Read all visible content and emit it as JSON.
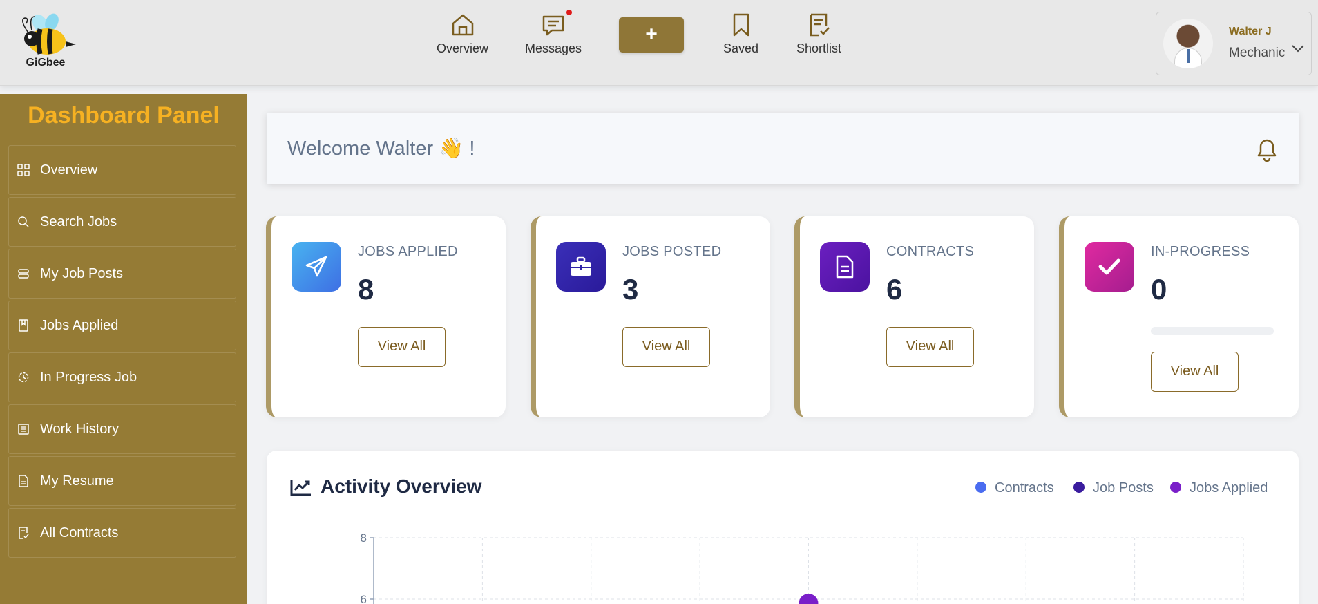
{
  "app": {
    "logo_text": "GiGbee"
  },
  "topnav": {
    "overview": "Overview",
    "messages": "Messages",
    "add": "+",
    "saved": "Saved",
    "shortlist": "Shortlist"
  },
  "profile": {
    "name": "Walter J",
    "role": "Mechanic"
  },
  "sidebar": {
    "title": "Dashboard Panel",
    "items": [
      {
        "label": "Overview",
        "icon": "grid-icon"
      },
      {
        "label": "Search Jobs",
        "icon": "search-icon"
      },
      {
        "label": "My Job Posts",
        "icon": "stack-icon"
      },
      {
        "label": "Jobs Applied",
        "icon": "bookmark-icon"
      },
      {
        "label": "In Progress Job",
        "icon": "clock-icon"
      },
      {
        "label": "Work History",
        "icon": "list-icon"
      },
      {
        "label": "My Resume",
        "icon": "document-icon"
      },
      {
        "label": "All Contracts",
        "icon": "contract-icon"
      }
    ]
  },
  "welcome": {
    "text": "Welcome Walter 👋 !"
  },
  "cards": [
    {
      "label": "JOBS APPLIED",
      "value": "8",
      "button": "View All",
      "icon": "paper-plane-icon",
      "color": "#3f8ee8"
    },
    {
      "label": "JOBS POSTED",
      "value": "3",
      "button": "View All",
      "icon": "briefcase-icon",
      "color": "#3a22a8"
    },
    {
      "label": "CONTRACTS",
      "value": "6",
      "button": "View All",
      "icon": "document-icon",
      "color": "#5b1aa8"
    },
    {
      "label": "IN-PROGRESS",
      "value": "0",
      "button": "View All",
      "icon": "check-icon",
      "color": "#c4249a"
    }
  ],
  "activity": {
    "title": "Activity Overview",
    "legend": [
      {
        "label": "Contracts",
        "color": "#4a6cf0"
      },
      {
        "label": "Job Posts",
        "color": "#3a1c9e"
      },
      {
        "label": "Jobs Applied",
        "color": "#7a1fc9"
      }
    ]
  },
  "chart_data": {
    "type": "line",
    "ylim": [
      0,
      8
    ],
    "y_ticks": [
      "8",
      "6"
    ],
    "grid": true,
    "series": [
      {
        "name": "Jobs Applied",
        "visible_point": {
          "value": 6
        }
      }
    ]
  }
}
